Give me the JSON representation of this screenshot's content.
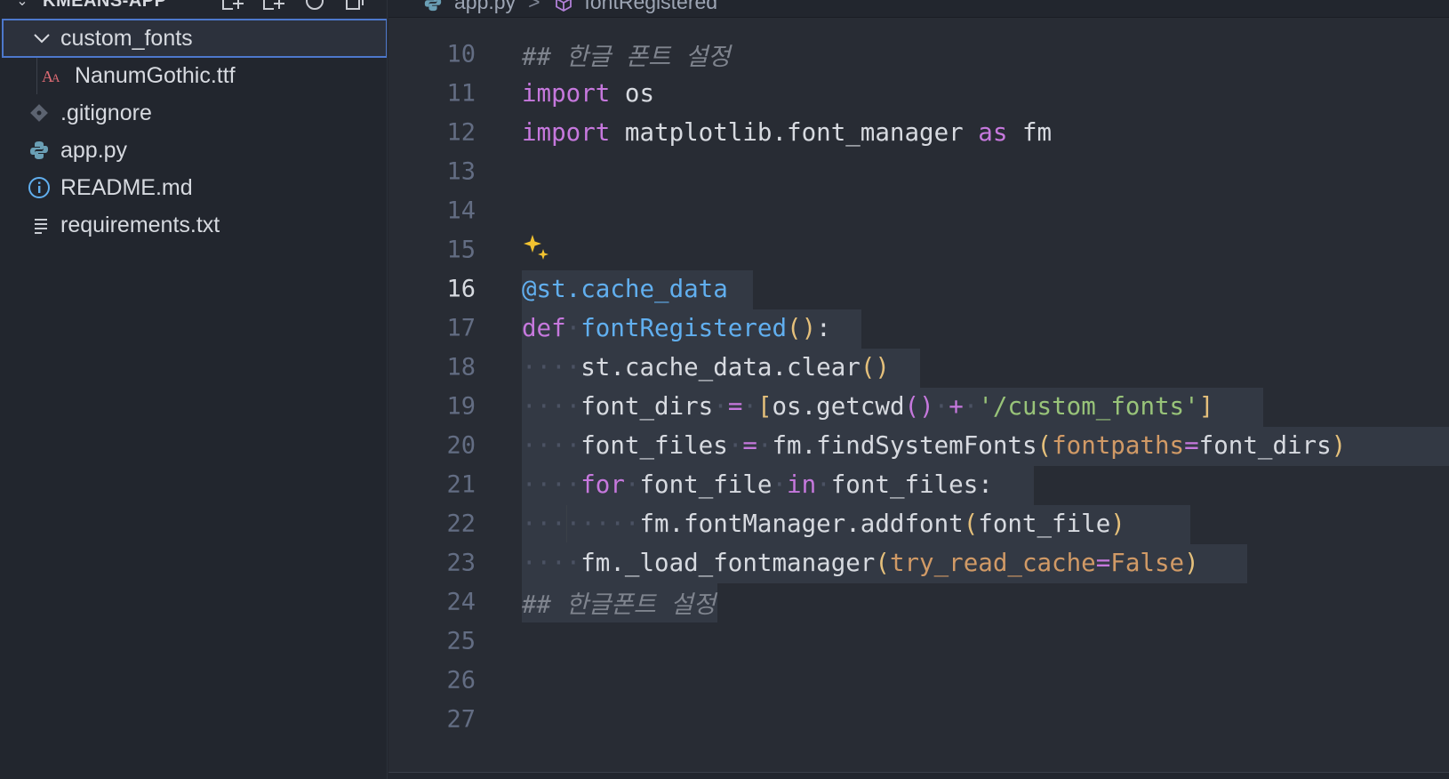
{
  "sidebar": {
    "title": "KMEANS-APP",
    "actions": [
      "new-file-icon",
      "new-folder-icon",
      "refresh-icon",
      "collapse-all-icon"
    ],
    "items": [
      {
        "label": "custom_fonts",
        "icon": "chevron-down-icon",
        "selected": true
      },
      {
        "label": "NanumGothic.ttf",
        "icon": "font-file-icon"
      },
      {
        "label": ".gitignore",
        "icon": "git-icon"
      },
      {
        "label": "app.py",
        "icon": "python-icon"
      },
      {
        "label": "README.md",
        "icon": "info-icon"
      },
      {
        "label": "requirements.txt",
        "icon": "text-file-icon"
      }
    ]
  },
  "breadcrumb": {
    "file": "app.py",
    "separator": ">",
    "symbol": "fontRegistered"
  },
  "editor": {
    "active_line": "16",
    "lines": [
      {
        "n": "10",
        "code": "## 한글 폰트 설정"
      },
      {
        "n": "11",
        "code": "import os"
      },
      {
        "n": "12",
        "code": "import matplotlib.font_manager as fm"
      },
      {
        "n": "13",
        "code": ""
      },
      {
        "n": "14",
        "code": ""
      },
      {
        "n": "15",
        "code": ""
      },
      {
        "n": "16",
        "code": "@st.cache_data"
      },
      {
        "n": "17",
        "code": "def fontRegistered():"
      },
      {
        "n": "18",
        "code": "    st.cache_data.clear()"
      },
      {
        "n": "19",
        "code": "    font_dirs = [os.getcwd() + '/custom_fonts']"
      },
      {
        "n": "20",
        "code": "    font_files = fm.findSystemFonts(fontpaths=font_dirs)"
      },
      {
        "n": "21",
        "code": "    for font_file in font_files:"
      },
      {
        "n": "22",
        "code": "        fm.fontManager.addfont(font_file)"
      },
      {
        "n": "23",
        "code": "    fm._load_fontmanager(try_read_cache=False)"
      },
      {
        "n": "24",
        "code": "## 한글폰트 설정"
      },
      {
        "n": "25",
        "code": ""
      },
      {
        "n": "26",
        "code": ""
      },
      {
        "n": "27",
        "code": ""
      }
    ],
    "gutter_icon": "sparkle-icon"
  },
  "colors": {
    "sidebar_bg": "#22262e",
    "editor_bg": "#282c34",
    "selection_bg": "#333944",
    "keyword": "#c678dd",
    "function": "#61afef",
    "string": "#98c379",
    "parameter": "#d19a66",
    "bracket": "#e5c07b",
    "focus_border": "#4d78cc"
  }
}
